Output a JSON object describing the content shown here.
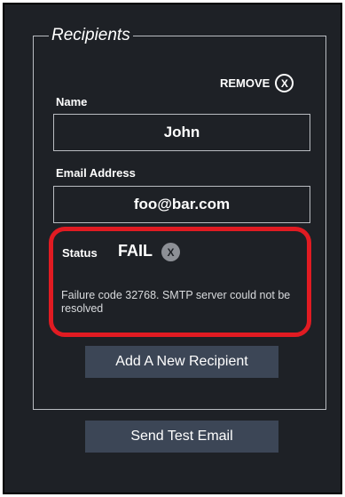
{
  "recipients": {
    "legend": "Recipients",
    "remove_label": "REMOVE",
    "remove_icon_glyph": "X",
    "name_label": "Name",
    "name_value": "John",
    "email_label": "Email Address",
    "email_value": "foo@bar.com",
    "status_label": "Status",
    "status_value": "FAIL",
    "status_icon_glyph": "X",
    "failure_message": "Failure code 32768. SMTP server could not be resolved",
    "add_button_label": "Add A New Recipient"
  },
  "send_test_label": "Send Test Email",
  "colors": {
    "background": "#1e2126",
    "highlight": "#e11b22",
    "button": "#3c4656"
  }
}
